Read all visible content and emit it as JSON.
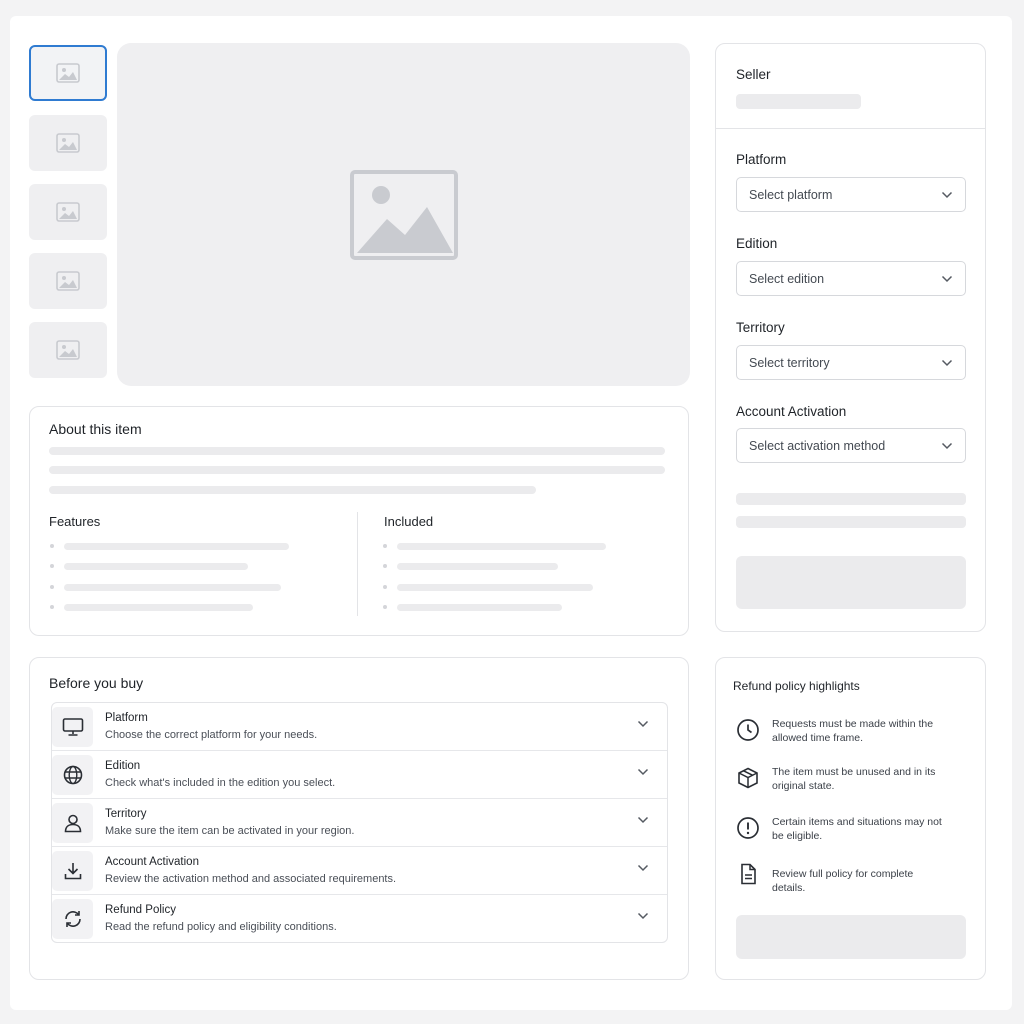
{
  "seller": {
    "label": "Seller"
  },
  "options": {
    "platform": {
      "label": "Platform",
      "placeholder": "Select platform"
    },
    "edition": {
      "label": "Edition",
      "placeholder": "Select edition"
    },
    "territory": {
      "label": "Territory",
      "placeholder": "Select territory"
    },
    "activation": {
      "label": "Account Activation",
      "placeholder": "Select activation method"
    }
  },
  "about": {
    "title": "About this item",
    "features_label": "Features",
    "included_label": "Included"
  },
  "before_buy": {
    "title": "Before you buy",
    "items": [
      {
        "title": "Platform",
        "desc": "Choose the correct platform for your needs.",
        "icon": "monitor-icon"
      },
      {
        "title": "Edition",
        "desc": "Check what's included in the edition you select.",
        "icon": "globe-icon"
      },
      {
        "title": "Territory",
        "desc": "Make sure the item can be activated in your region.",
        "icon": "user-icon"
      },
      {
        "title": "Account Activation",
        "desc": "Review the activation method and associated requirements.",
        "icon": "download-icon"
      },
      {
        "title": "Refund Policy",
        "desc": "Read the refund policy and eligibility conditions.",
        "icon": "refresh-icon"
      }
    ]
  },
  "refund": {
    "title": "Refund policy highlights",
    "items": [
      {
        "text": "Requests must be made within the allowed time frame.",
        "icon": "clock-icon"
      },
      {
        "text": "The item must be unused and in its original state.",
        "icon": "box-icon"
      },
      {
        "text": "Certain items and situations may not be eligible.",
        "icon": "alert-icon"
      },
      {
        "text": "Review full policy for complete details.",
        "icon": "document-icon"
      }
    ]
  },
  "colors": {
    "accent": "#2f7bd1",
    "skeleton": "#ebebed",
    "border": "#e3e4e7"
  }
}
